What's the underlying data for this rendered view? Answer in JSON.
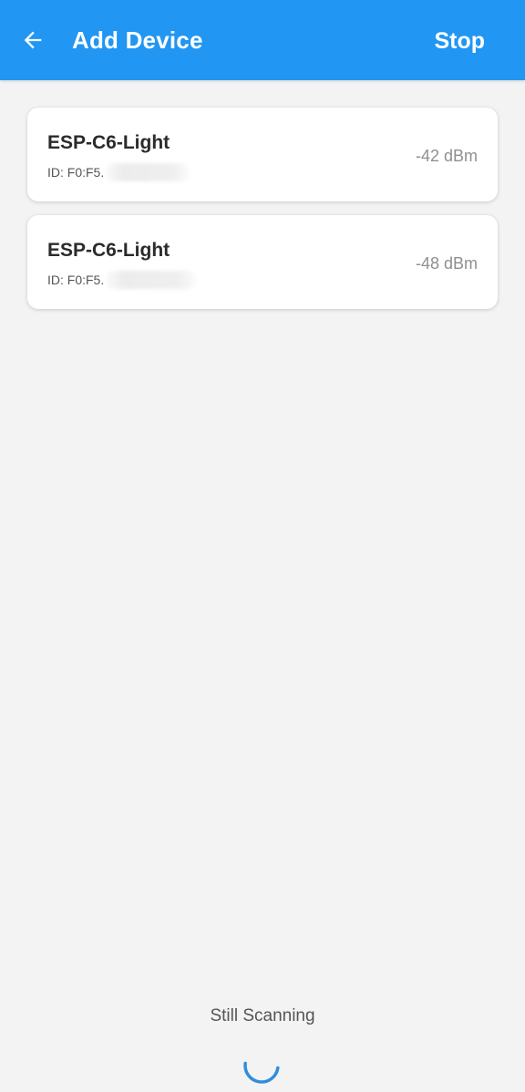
{
  "appbar": {
    "title": "Add Device",
    "back_icon": "arrow-left-icon",
    "stop_label": "Stop",
    "background_color": "#2196f3"
  },
  "devices": [
    {
      "name": "ESP-C6-Light",
      "id_prefix": "ID: F0:F5.",
      "rssi": "-42 dBm"
    },
    {
      "name": "ESP-C6-Light",
      "id_prefix": "ID: F0:F5.",
      "rssi": "-48 dBm"
    }
  ],
  "status": {
    "text": "Still Scanning",
    "spinner_icon": "loading-spinner-icon",
    "spinner_color": "#2f8ede"
  }
}
